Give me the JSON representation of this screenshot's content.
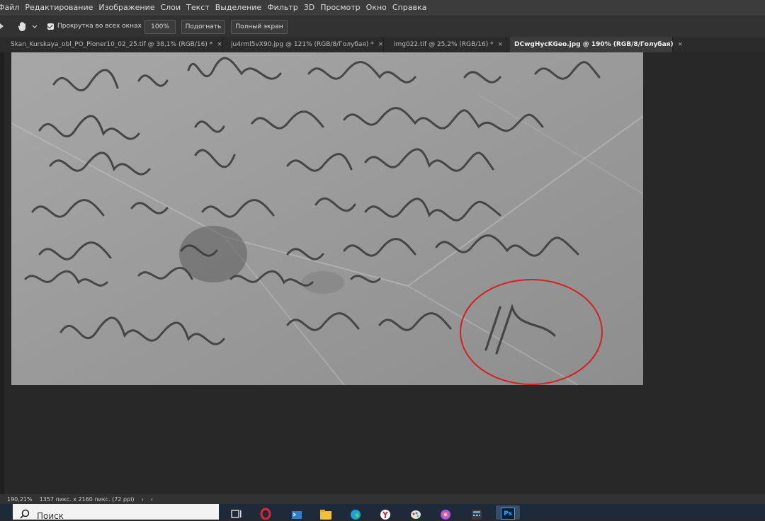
{
  "menu": [
    "Файл",
    "Редактирование",
    "Изображение",
    "Слои",
    "Текст",
    "Выделение",
    "Фильтр",
    "3D",
    "Просмотр",
    "Окно",
    "Справка"
  ],
  "options": {
    "scroll_all_label": "Прокрутка во всех окнах",
    "zoom_100": "100%",
    "fit_screen": "Подогнать",
    "full_screen": "Полный экран"
  },
  "tabs": [
    {
      "label": "Skan_Kurskaya_obl_PO_Pioner10_02_25.tif @ 38,1% (RGB/16) *",
      "close": "×"
    },
    {
      "label": "ju4rml5vX90.jpg @ 121% (RGB/8/Голубая) *",
      "close": "×"
    },
    {
      "label": "img022.tif @ 25,2% (RGB/16) *",
      "close": "×"
    },
    {
      "label": "DCwgHycKGeo.jpg @ 190% (RGB/8/Голубая)",
      "close": "×"
    }
  ],
  "letter_lines": [
    "2 да и в дороги послала и уже",
    "отсюда и чего вы не получаете",
    "незнаю. Враг от нас бежит",
    "и мы его гоним в море пока",
    "писать не буду. не чего днев - здоров",
    "передай привет во знакомым",
    "досвидание вам брат Жора"
  ],
  "status": {
    "zoom": "190,21%",
    "doc_info": "1357 пикс. x 2160 пикс. (72 ppi)",
    "arrow_right": "›",
    "arrow_left": "‹"
  },
  "taskbar": {
    "search_placeholder": "Поиск",
    "ps_label": "Ps"
  },
  "colors": {
    "annotation_circle": "#d42020",
    "ps_blue": "#31a8ff"
  }
}
